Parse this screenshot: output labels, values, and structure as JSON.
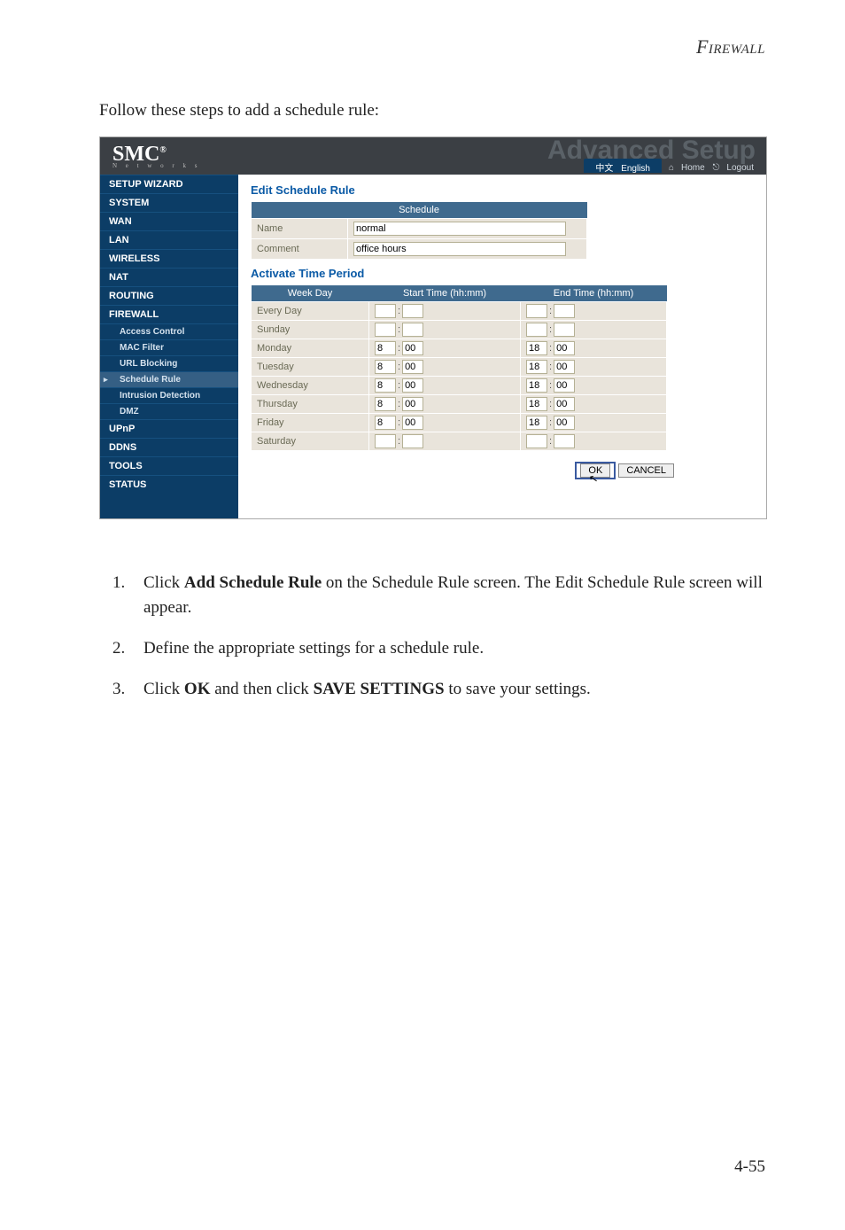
{
  "doc": {
    "header": "Firewall",
    "intro": "Follow these steps to add a schedule rule:",
    "step1_a": "Click ",
    "step1_b": "Add Schedule Rule",
    "step1_c": " on the Schedule Rule screen. The Edit Schedule Rule screen will appear.",
    "step2": "Define the appropriate settings for a schedule rule.",
    "step3_a": "Click ",
    "step3_b": "OK",
    "step3_c": " and then click ",
    "step3_d": "SAVE SETTINGS",
    "step3_e": " to save your settings.",
    "pagenum": "4-55"
  },
  "app": {
    "brand": "SMC",
    "brand_sup": "®",
    "brand_sub": "N e t w o r k s",
    "watermark": "Advanced Setup",
    "lang_cn": "中文",
    "lang_en": "English",
    "link_home": "Home",
    "link_logout": "Logout",
    "sidebar": {
      "setup_wizard": "SETUP WIZARD",
      "system": "SYSTEM",
      "wan": "WAN",
      "lan": "LAN",
      "wireless": "WIRELESS",
      "nat": "NAT",
      "routing": "ROUTING",
      "firewall": "FIREWALL",
      "access_control": "Access Control",
      "mac_filter": "MAC Filter",
      "url_blocking": "URL Blocking",
      "schedule_rule": "Schedule Rule",
      "intrusion_detection": "Intrusion Detection",
      "dmz": "DMZ",
      "upnp": "UPnP",
      "ddns": "DDNS",
      "tools": "TOOLS",
      "status": "STATUS"
    },
    "content": {
      "edit_title": "Edit Schedule Rule",
      "schedule_head": "Schedule",
      "name_label": "Name",
      "name_value": "normal",
      "comment_label": "Comment",
      "comment_value": "office hours",
      "activate_title": "Activate Time Period",
      "col_weekday": "Week Day",
      "col_start": "Start Time (hh:mm)",
      "col_end": "End Time (hh:mm)",
      "rows": [
        {
          "day": "Every Day",
          "sh": "",
          "sm": "",
          "eh": "",
          "em": ""
        },
        {
          "day": "Sunday",
          "sh": "",
          "sm": "",
          "eh": "",
          "em": ""
        },
        {
          "day": "Monday",
          "sh": "8",
          "sm": "00",
          "eh": "18",
          "em": "00"
        },
        {
          "day": "Tuesday",
          "sh": "8",
          "sm": "00",
          "eh": "18",
          "em": "00"
        },
        {
          "day": "Wednesday",
          "sh": "8",
          "sm": "00",
          "eh": "18",
          "em": "00"
        },
        {
          "day": "Thursday",
          "sh": "8",
          "sm": "00",
          "eh": "18",
          "em": "00"
        },
        {
          "day": "Friday",
          "sh": "8",
          "sm": "00",
          "eh": "18",
          "em": "00"
        },
        {
          "day": "Saturday",
          "sh": "",
          "sm": "",
          "eh": "",
          "em": ""
        }
      ],
      "ok": "OK",
      "cancel": "CANCEL"
    }
  }
}
